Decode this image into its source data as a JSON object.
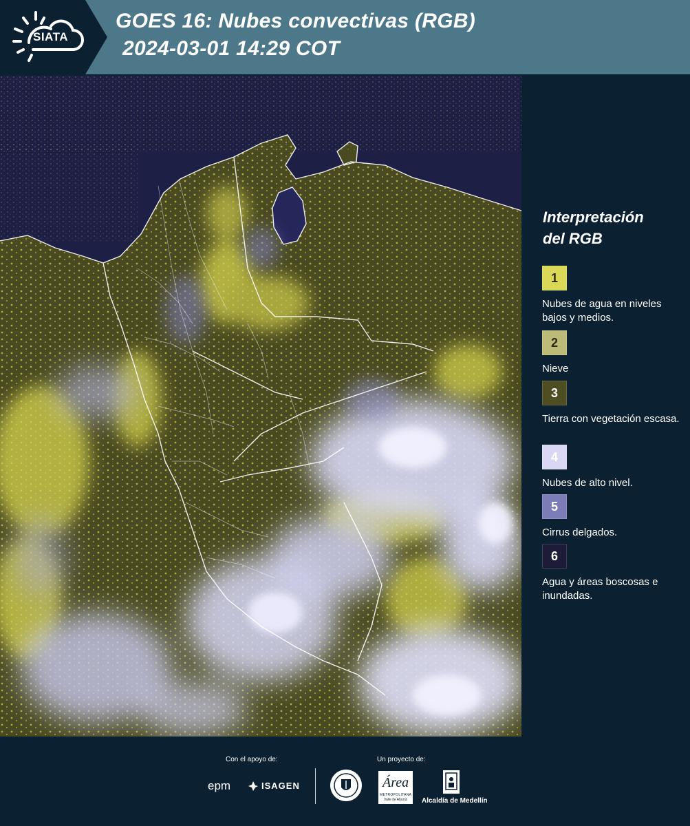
{
  "header": {
    "logo_text": "SIATA",
    "title_line1": "GOES 16: Nubes convectivas (RGB)",
    "title_line2": "2024-03-01 14:29 COT"
  },
  "legend": {
    "title_line1": "Interpretación",
    "title_line2": "del RGB",
    "items": [
      {
        "number": "1",
        "label": "Nubes de agua en niveles bajos y medios.",
        "color": "#d9d957",
        "text_color": "#2a2a10"
      },
      {
        "number": "2",
        "label": "Nieve",
        "color": "#bcbc78",
        "text_color": "#2a2a10"
      },
      {
        "number": "3",
        "label": "Tierra con vegetación escasa.",
        "color": "#4e4e22",
        "text_color": "#ffffff"
      },
      {
        "number": "4",
        "label": "Nubes de alto nivel.",
        "color": "#d8d8f4",
        "text_color": "#ffffff"
      },
      {
        "number": "5",
        "label": "Cirrus delgados.",
        "color": "#7c7cb8",
        "text_color": "#ffffff"
      },
      {
        "number": "6",
        "label": "Agua y áreas boscosas e inundadas.",
        "color": "#1c1c38",
        "text_color": "#ffffff"
      }
    ]
  },
  "footer": {
    "support_label": "Con el apoyo de:",
    "project_label": "Un proyecto de:",
    "epm_text": "epm",
    "isagen_text": "ISAGEN",
    "area_text": "Área",
    "area_sub1": "METROPOLITANA",
    "area_sub2": "Valle de Aburrá",
    "alcaldia_text": "Alcaldía de Medellín"
  },
  "colors": {
    "header_bg": "#4d7889",
    "panel_bg": "#0b2030",
    "ocean": "#1d1f45",
    "land": "#4a4a22",
    "low_cloud": "#d6d44e",
    "high_cloud": "#dcdcf8",
    "cirrus": "#8282c6"
  }
}
